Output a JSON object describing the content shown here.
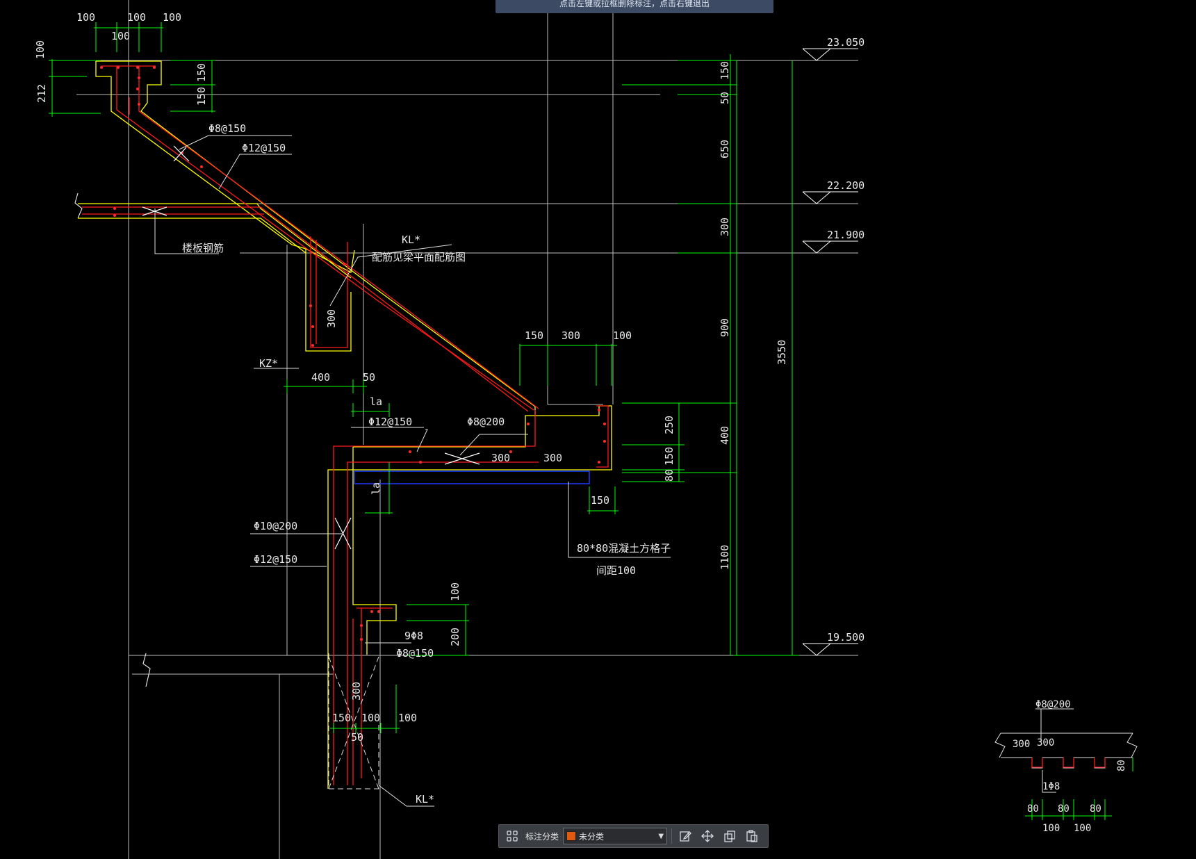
{
  "hint": {
    "text": "点击左键或拉框删除标注，点击右键退出"
  },
  "toolbar": {
    "label": "标注分类",
    "category_value": "未分类",
    "category_color": "#e05a10",
    "icons": [
      "grid-icon",
      "edit-icon",
      "move-icon",
      "copy-icon",
      "paste-icon"
    ]
  },
  "colors": {
    "background": "#000000",
    "outline": "#ffff00",
    "rebar": "#ff0000",
    "dimension": "#00ff00",
    "text": "#e8e8e8",
    "grid": "#c8c8c8",
    "blue_strip": "#1f3bff"
  },
  "drawing": {
    "top_dims": [
      "100",
      "100",
      "100",
      "100"
    ],
    "left_dims": [
      "100",
      "212",
      "150",
      "150"
    ],
    "rebar_labels": {
      "phi8_150_top": "Φ8@150",
      "phi12_150_top": "Φ12@150",
      "slab_rebar": "楼板钢筋",
      "kl_star_top": "KL*",
      "kl_note": "配筋见梁平面配筋图",
      "kl_depth": "300",
      "kz_star": "KZ*",
      "dim_400": "400",
      "dim_50": "50",
      "la_top": "la",
      "phi12_150_mid": "Φ12@150",
      "phi8_200_mid": "Φ8@200",
      "dim_300_a": "300",
      "dim_300_b": "300",
      "la_vert": "la",
      "strip_note": "80*80混凝土方格子",
      "strip_spacing": "间距100",
      "dim_150_bot": "150",
      "phi10_200": "Φ10@200",
      "phi12_150_left": "Φ12@150",
      "dim_100_r": "100",
      "dim_200_r": "200",
      "nine_phi8": "9Φ8",
      "phi8_150_bot": "Φ8@150",
      "dim_300_v": "300",
      "dim_150_b": "150",
      "dim_100_b": "100",
      "dim_100_b2": "100",
      "dim_50_b": "50",
      "kl_star_bot": "KL*"
    },
    "upper_right_dims": [
      "150",
      "300",
      "100"
    ],
    "mid_right_dims": [
      "250",
      "150",
      "80"
    ],
    "vertical_chain": [
      "150",
      "50",
      "650",
      "300",
      "900",
      "400",
      "1100"
    ],
    "total_height": "3550",
    "elevations": [
      "23.050",
      "22.200",
      "21.900",
      "19.500"
    ],
    "detail": {
      "top_label": "Φ8@200",
      "dim_300_a": "300",
      "dim_300_b": "300",
      "dim_80_right": "80",
      "bar_label": "1Φ8",
      "bottom_80": [
        "80",
        "80",
        "80"
      ],
      "bottom_100": [
        "100",
        "100"
      ]
    }
  }
}
